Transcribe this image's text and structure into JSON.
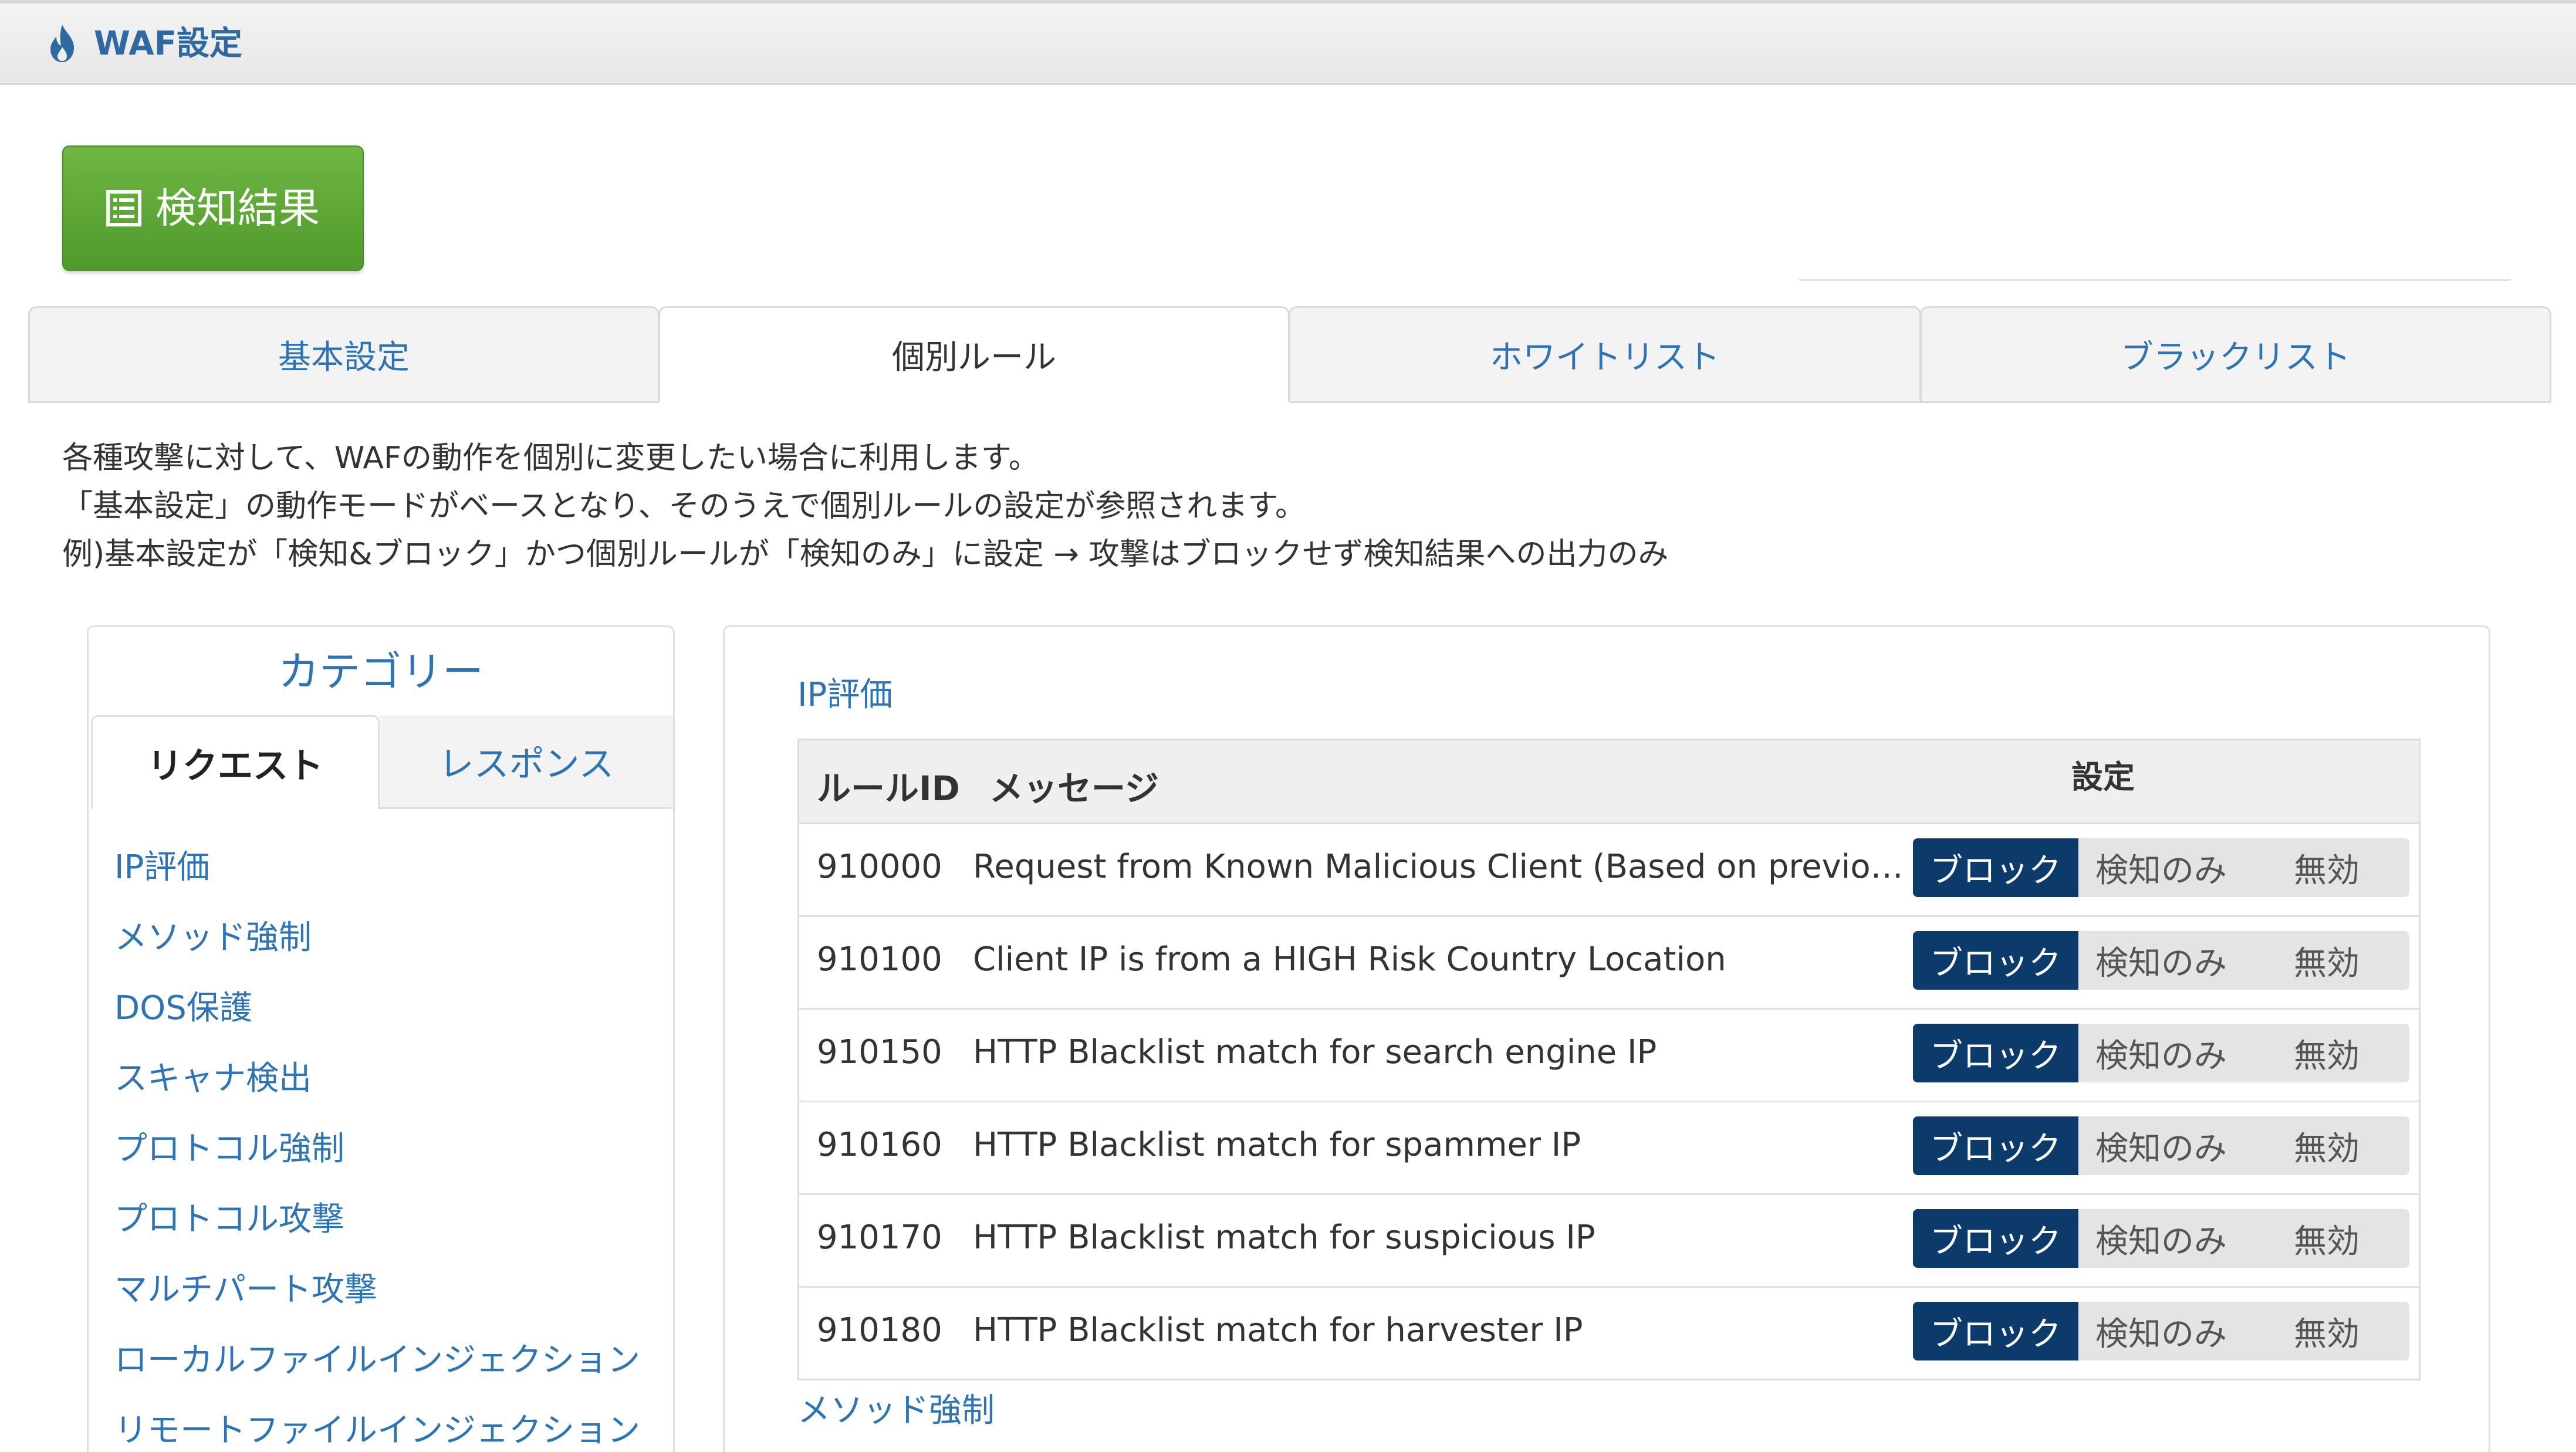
{
  "header": {
    "title": "WAF設定",
    "icon": "fire-icon"
  },
  "result_button": {
    "label": "検知結果",
    "icon": "document-list-icon",
    "color": "#5ea838"
  },
  "tabs": [
    {
      "label": "基本設定",
      "active": false
    },
    {
      "label": "個別ルール",
      "active": true
    },
    {
      "label": "ホワイトリスト",
      "active": false
    },
    {
      "label": "ブラックリスト",
      "active": false
    }
  ],
  "description": [
    "各種攻撃に対して、WAFの動作を個別に変更したい場合に利用します。",
    "「基本設定」の動作モードがベースとなり、そのうえで個別ルールの設定が参照されます。",
    "例)基本設定が「検知&ブロック」かつ個別ルールが「検知のみ」に設定 → 攻撃はブロックせず検知結果への出力のみ"
  ],
  "category": {
    "title": "カテゴリー",
    "subtabs": [
      {
        "label": "リクエスト",
        "active": true
      },
      {
        "label": "レスポンス",
        "active": false
      }
    ],
    "items": [
      "IP評価",
      "メソッド強制",
      "DOS保護",
      "スキャナ検出",
      "プロトコル強制",
      "プロトコル攻撃",
      "マルチパート攻撃",
      "ローカルファイルインジェクション",
      "リモートファイルインジェクション"
    ]
  },
  "rules": {
    "section_title": "IP評価",
    "next_section_title": "メソッド強制",
    "columns": {
      "id": "ルールID",
      "message": "メッセージ",
      "setting": "設定"
    },
    "options": {
      "block": "ブロック",
      "detect": "検知のみ",
      "disable": "無効"
    },
    "rows": [
      {
        "id": "910000",
        "message": "Request from Known Malicious Client (Based on previous tra…",
        "selected": "block"
      },
      {
        "id": "910100",
        "message": "Client IP is from a HIGH Risk Country Location",
        "selected": "block"
      },
      {
        "id": "910150",
        "message": "HTTP Blacklist match for search engine IP",
        "selected": "block"
      },
      {
        "id": "910160",
        "message": "HTTP Blacklist match for spammer IP",
        "selected": "block"
      },
      {
        "id": "910170",
        "message": "HTTP Blacklist match for suspicious IP",
        "selected": "block"
      },
      {
        "id": "910180",
        "message": "HTTP Blacklist match for harvester IP",
        "selected": "block"
      }
    ]
  },
  "colors": {
    "accent": "#2e74b5",
    "selected": "#0b3a6b",
    "unselected": "#e4e4e4"
  }
}
